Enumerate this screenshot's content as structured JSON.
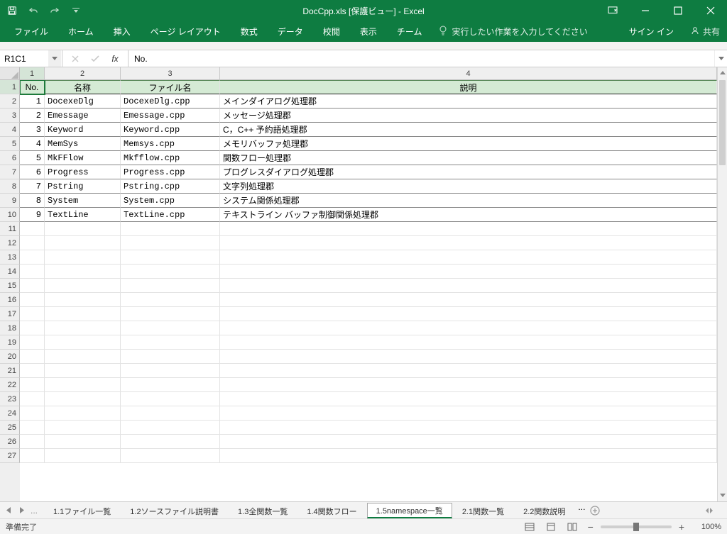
{
  "window": {
    "title": "DocCpp.xls  [保護ビュー] - Excel"
  },
  "ribbon": {
    "tabs": [
      "ファイル",
      "ホーム",
      "挿入",
      "ページ レイアウト",
      "数式",
      "データ",
      "校閲",
      "表示",
      "チーム"
    ],
    "tellme": "実行したい作業を入力してください",
    "signin": "サイン イン",
    "share": "共有"
  },
  "namebox": {
    "value": "R1C1"
  },
  "formula": {
    "value": "No."
  },
  "columns": [
    "1",
    "2",
    "3",
    "4"
  ],
  "row_numbers": [
    "1",
    "2",
    "3",
    "4",
    "5",
    "6",
    "7",
    "8",
    "9",
    "10",
    "11",
    "12",
    "13",
    "14",
    "15",
    "16",
    "17",
    "18",
    "19",
    "20",
    "21",
    "22",
    "23",
    "24",
    "25",
    "26",
    "27"
  ],
  "headers": {
    "no": "No.",
    "name": "名称",
    "file": "ファイル名",
    "desc": "説明"
  },
  "data": [
    {
      "no": "1",
      "name": "DocexeDlg",
      "file": "DocexeDlg.cpp",
      "desc": "メインダイアログ処理郡"
    },
    {
      "no": "2",
      "name": "Emessage",
      "file": "Emessage.cpp",
      "desc": "メッセージ処理郡"
    },
    {
      "no": "3",
      "name": "Keyword",
      "file": "Keyword.cpp",
      "desc": "C，C++ 予約語処理郡"
    },
    {
      "no": "4",
      "name": "MemSys",
      "file": "Memsys.cpp",
      "desc": "メモリバッファ処理郡"
    },
    {
      "no": "5",
      "name": "MkFFlow",
      "file": "Mkfflow.cpp",
      "desc": "関数フロー処理郡"
    },
    {
      "no": "6",
      "name": "Progress",
      "file": "Progress.cpp",
      "desc": "プログレスダイアログ処理郡"
    },
    {
      "no": "7",
      "name": "Pstring",
      "file": "Pstring.cpp",
      "desc": "文字列処理郡"
    },
    {
      "no": "8",
      "name": "System",
      "file": "System.cpp",
      "desc": "システム関係処理郡"
    },
    {
      "no": "9",
      "name": "TextLine",
      "file": "TextLine.cpp",
      "desc": "テキストライン バッファ制御関係処理郡"
    }
  ],
  "sheets": {
    "tabs": [
      "1.1ファイル一覧",
      "1.2ソースファイル説明書",
      "1.3全関数一覧",
      "1.4関数フロー",
      "1.5namespace一覧",
      "2.1関数一覧",
      "2.2関数説明"
    ],
    "active_index": 4,
    "ellipsis": "..."
  },
  "status": {
    "ready": "準備完了",
    "zoom": "100%"
  }
}
